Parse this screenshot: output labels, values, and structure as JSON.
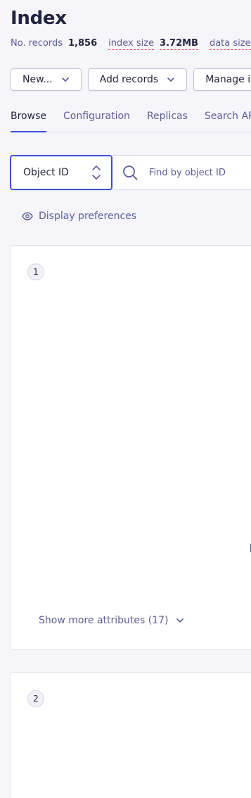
{
  "page": {
    "title": "Index"
  },
  "stats": {
    "records_label": "No. records",
    "records_value": "1,856",
    "index_size_label": "index size",
    "index_size_value": "3.72MB",
    "data_size_label": "data size"
  },
  "actions": {
    "new_label": "New...",
    "add_records_label": "Add records",
    "manage_index_label": "Manage index"
  },
  "tabs": [
    {
      "label": "Browse",
      "active": true
    },
    {
      "label": "Configuration",
      "active": false
    },
    {
      "label": "Replicas",
      "active": false
    },
    {
      "label": "Search API Logs",
      "active": false
    }
  ],
  "search": {
    "select_value": "Object ID",
    "placeholder": "Find by object ID"
  },
  "display_preferences_label": "Display preferences",
  "records": [
    {
      "index": "1",
      "show_more_label": "Show more attributes (17)"
    },
    {
      "index": "2"
    }
  ],
  "colors": {
    "accent": "#3c4fe0",
    "muted_text": "#5a5e9a",
    "heading": "#21243d",
    "dashed_underline": "#e8505b",
    "background": "#f5f5fa"
  }
}
